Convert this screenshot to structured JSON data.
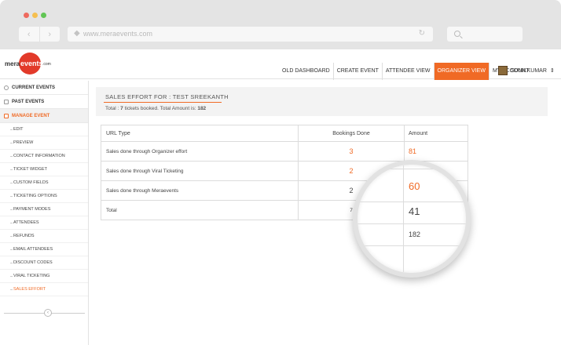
{
  "browser": {
    "dot_colors": [
      "#ee6a5e",
      "#f5bf4f",
      "#61c554"
    ],
    "url": "www.meraevents.com",
    "back_icon": "‹",
    "forward_icon": "›",
    "lock_icon": "◆",
    "reload_icon": "↻"
  },
  "logo": {
    "mera": "mera",
    "events": "events",
    "com": ".com"
  },
  "topnav": {
    "items": [
      "OLD DASHBOARD",
      "CREATE EVENT",
      "ATTENDEE VIEW",
      "ORGANIZER VIEW",
      "MY ACCOUNT"
    ],
    "active_index": 3,
    "accent": "#f06a25"
  },
  "user": {
    "name": "SUNILKUMAR",
    "caret": "⇕"
  },
  "sidebar": {
    "current_events": "CURRENT EVENTS",
    "past_events": "PAST EVENTS",
    "manage_event": "MANAGE EVENT",
    "sub_items": [
      "EDIT",
      "PREVIEW",
      "CONTACT INFORMATION",
      "TICKET WIDGET",
      "CUSTOM FIELDS",
      "TICKETING OPTIONS",
      "PAYMENT MODES",
      "ATTENDEES",
      "REFUNDS",
      "EMAIL ATTENDEES",
      "DISCOUNT CODES",
      "VIRAL TICKETING",
      "SALES EFFORT"
    ],
    "active_item": "SALES EFFORT",
    "collapse_icon": "‹"
  },
  "main": {
    "title": "SALES EFFORT FOR : TEST SREEKANTH",
    "summary_prefix": "Total : ",
    "summary_tickets": "7",
    "summary_middle": " tickets booked. Total Amount is: ",
    "summary_amount": "182"
  },
  "table": {
    "headers": [
      "URL Type",
      "Bookings Done",
      "Amount"
    ],
    "rows": [
      {
        "type": "Sales done through Organizer effort",
        "bookings": "3",
        "amount": "81"
      },
      {
        "type": "Sales done through Viral Ticketing",
        "bookings": "2",
        "amount": ""
      },
      {
        "type": "Sales done through Meraevents",
        "bookings": "2",
        "amount": ""
      },
      {
        "type": "Total",
        "bookings": "7",
        "amount": ""
      }
    ]
  },
  "magnifier": {
    "values": [
      "60",
      "41",
      "182"
    ]
  }
}
